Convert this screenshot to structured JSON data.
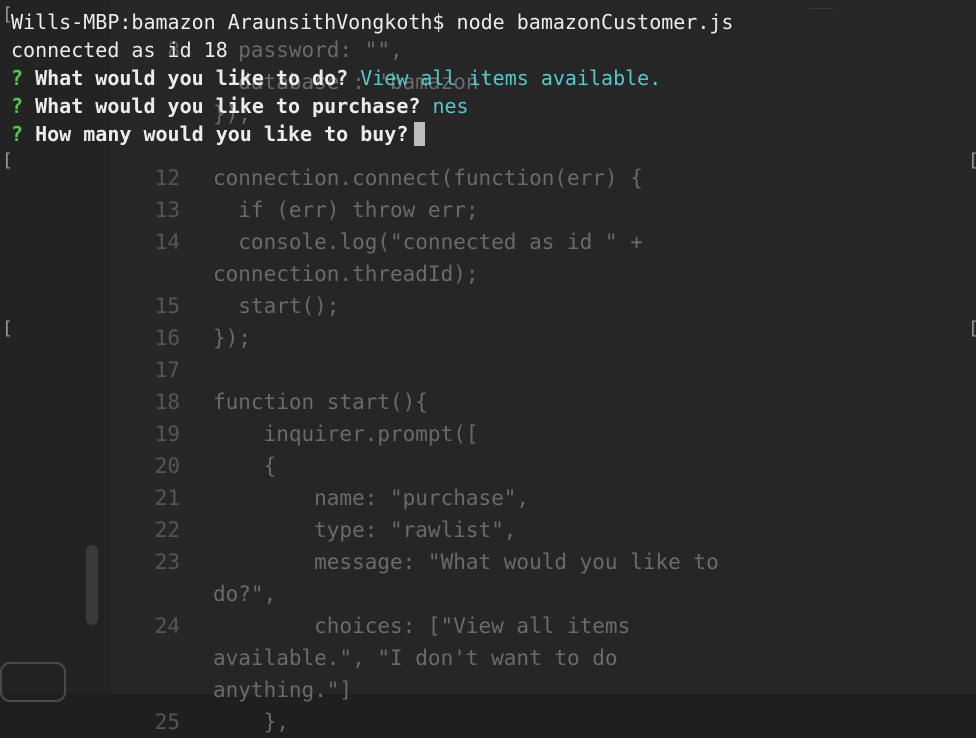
{
  "terminal": {
    "prompt_host": "Wills-MBP:bamazon AraunsithVongkoth$",
    "command": "node bamazonCustomer.js",
    "connected_line": "connected as id 18",
    "questions": [
      {
        "mark": "?",
        "text": "What would you like to do?",
        "answer": "View all items available."
      },
      {
        "mark": "?",
        "text": "What would you like to purchase?",
        "answer": "nes"
      },
      {
        "mark": "?",
        "text": "How many would you like to buy?",
        "answer": ""
      }
    ],
    "bracket": "["
  },
  "editor": {
    "lines": [
      {
        "num": "8",
        "code": "  password: \"\","
      },
      {
        "num": "",
        "code": "  database : 'bamazon'"
      },
      {
        "num": "",
        "code": "});"
      },
      {
        "num": "",
        "code": ""
      },
      {
        "num": "12",
        "code": "connection.connect(function(err) {"
      },
      {
        "num": "13",
        "code": "  if (err) throw err;"
      },
      {
        "num": "14",
        "code": "  console.log(\"connected as id \" +"
      },
      {
        "num": "",
        "code": "connection.threadId);"
      },
      {
        "num": "15",
        "code": "  start();"
      },
      {
        "num": "16",
        "code": "});"
      },
      {
        "num": "17",
        "code": ""
      },
      {
        "num": "18",
        "code": "function start(){"
      },
      {
        "num": "19",
        "code": "    inquirer.prompt(["
      },
      {
        "num": "20",
        "code": "    {"
      },
      {
        "num": "21",
        "code": "        name: \"purchase\","
      },
      {
        "num": "22",
        "code": "        type: \"rawlist\","
      },
      {
        "num": "23",
        "code": "        message: \"What would you like to"
      },
      {
        "num": "",
        "code": "do?\","
      },
      {
        "num": "24",
        "code": "        choices: [\"View all items"
      },
      {
        "num": "",
        "code": "available.\", \"I don't want to do"
      },
      {
        "num": "",
        "code": "anything.\"]"
      },
      {
        "num": "25",
        "code": "    },"
      }
    ]
  },
  "colors": {
    "background": "#1f1f1f",
    "question_mark": "#4ec94e",
    "answer": "#56c8c8",
    "terminal_text": "#ececec",
    "editor_text": "#6a6a6a",
    "line_number": "#565656"
  }
}
